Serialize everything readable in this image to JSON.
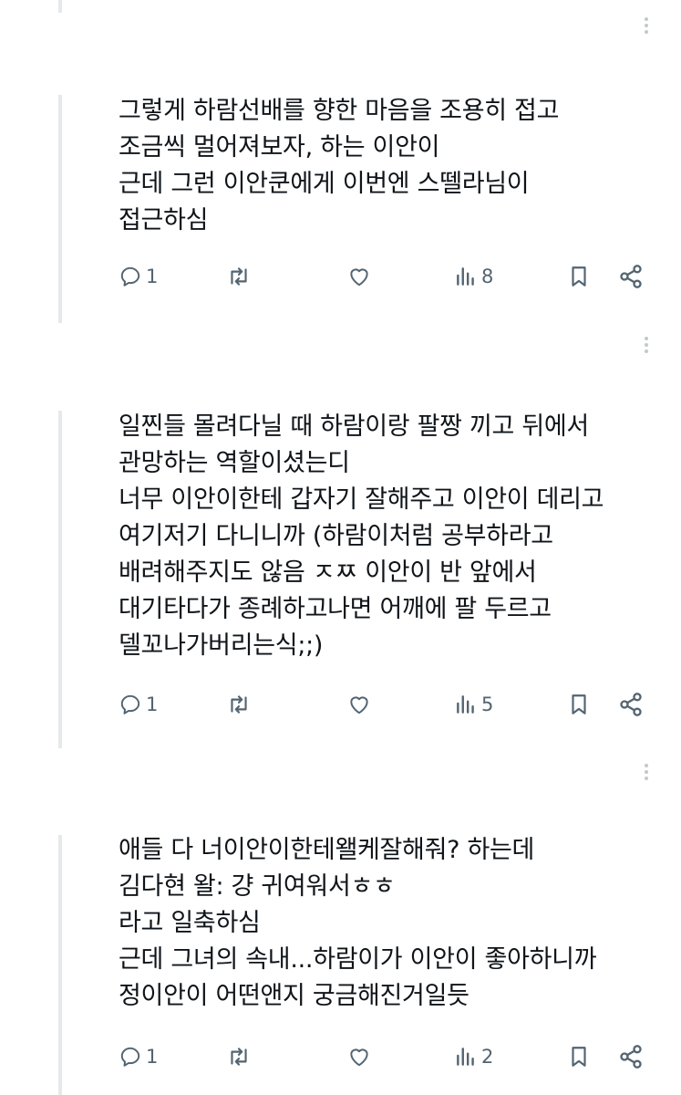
{
  "posts": [
    {
      "text": "그렇게 하람선배를 향한 마음을 조용히 접고\n조금씩 멀어져보자, 하는 이안이\n근데 그런 이안쿤에게 이번엔 스뗄라님이\n접근하심",
      "reply_count": "1",
      "view_count": "8"
    },
    {
      "text": "일찐들 몰려다닐 때 하람이랑 팔짱 끼고 뒤에서\n관망하는 역할이셨는디\n너무 이안이한테 갑자기 잘해주고 이안이 데리고\n여기저기 다니니까 (하람이처럼 공부하라고\n배려해주지도 않음 ㅈㅉ 이안이 반 앞에서\n대기타다가 종례하고나면 어깨에 팔 두르고\n델꼬나가버리는식;;)",
      "reply_count": "1",
      "view_count": "5"
    },
    {
      "text": "애들 다 너이안이한테왤케잘해줘? 하는데\n김다현 왈: 걍 귀여워서ㅎㅎ\n라고 일축하심\n근데 그녀의 속내...하람이가 이안이 좋아하니까\n정이안이 어떤앤지 궁금해진거일듯",
      "reply_count": "1",
      "view_count": "2"
    }
  ],
  "icons": {
    "reply": "reply-icon",
    "repost": "repost-icon",
    "like": "like-icon",
    "views": "views-icon",
    "bookmark": "bookmark-icon",
    "share": "share-icon",
    "more": "more-icon"
  },
  "colors": {
    "text": "#0f1419",
    "icon": "#536471",
    "thread_line": "#e6e9ec"
  }
}
